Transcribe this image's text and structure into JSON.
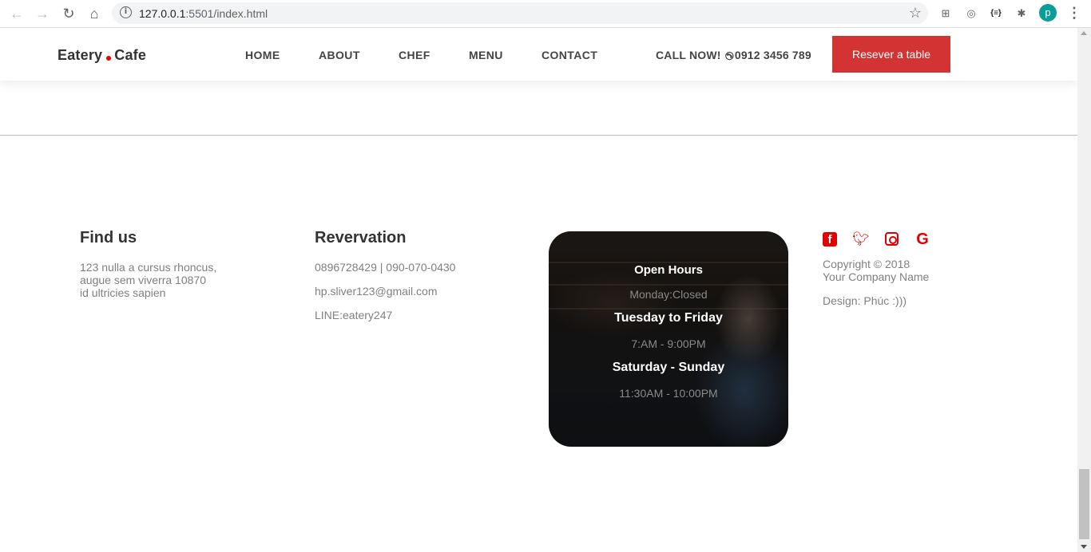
{
  "browser": {
    "url_host": "127.0.0.1",
    "url_rest": ":5501/index.html",
    "profile_initial": "p",
    "ext_label": "{≡}"
  },
  "header": {
    "logo_left": "Eatery",
    "logo_right": "Cafe",
    "menu": [
      {
        "label": "HOME"
      },
      {
        "label": "ABOUT"
      },
      {
        "label": "CHEF"
      },
      {
        "label": "MENU"
      },
      {
        "label": "CONTACT"
      }
    ],
    "call_label": "CALL NOW!",
    "phone": "0912 3456 789",
    "reserve_label": "Resever a table"
  },
  "footer": {
    "find_us": {
      "title": "Find us",
      "lines": [
        "123 nulla a cursus rhoncus,",
        "augue sem viverra 10870",
        "id ultricies sapien"
      ]
    },
    "reservation": {
      "title": "Revervation",
      "phones": "0896728429 | 090-070-0430",
      "email": "hp.sliver123@gmail.com",
      "line": "LINE:eatery247"
    },
    "hours": {
      "title": "Open Hours",
      "monday": "Monday:Closed",
      "weekday_title": "Tuesday to Friday",
      "weekday_hours": "7:AM - 9:00PM",
      "weekend_title": "Saturday - Sunday",
      "weekend_hours": "11:30AM - 10:00PM"
    },
    "social": {
      "copyright": "Copyright © 2018",
      "company": "Your Company Name",
      "design": "Design: Phúc :)))"
    }
  },
  "colors": {
    "accent": "#d33333",
    "social": "#e00000"
  }
}
